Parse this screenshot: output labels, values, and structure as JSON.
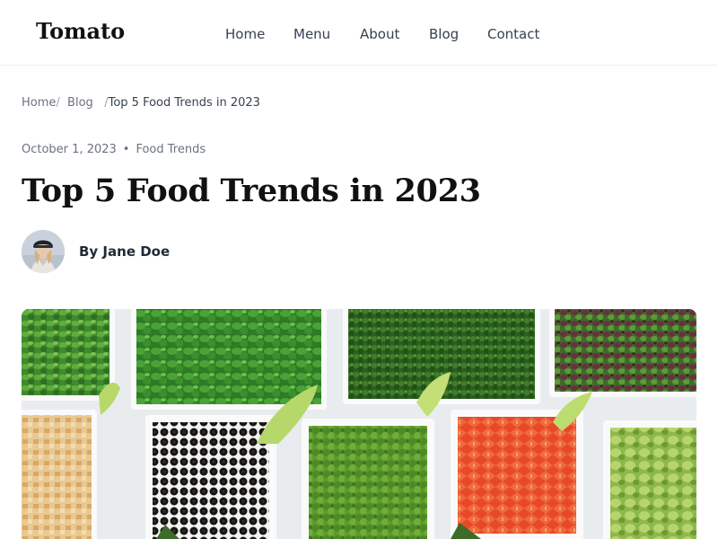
{
  "header": {
    "brand": "Tomato",
    "nav": [
      "Home",
      "Menu",
      "About",
      "Blog",
      "Contact"
    ]
  },
  "breadcrumb": {
    "home": "Home",
    "sep1": "/",
    "blog": "Blog",
    "sep2": "/",
    "current": "Top 5 Food Trends in 2023"
  },
  "post": {
    "date": "October 1, 2023",
    "separator": "•",
    "category": "Food Trends",
    "title": "Top 5 Food Trends in 2023",
    "author": "By Jane Doe",
    "hero_image_icon": "vegetable-bowls-photo"
  },
  "colors": {
    "text": "#111111",
    "nav": "#374151",
    "muted": "#6b7280",
    "border": "#eceef1"
  }
}
